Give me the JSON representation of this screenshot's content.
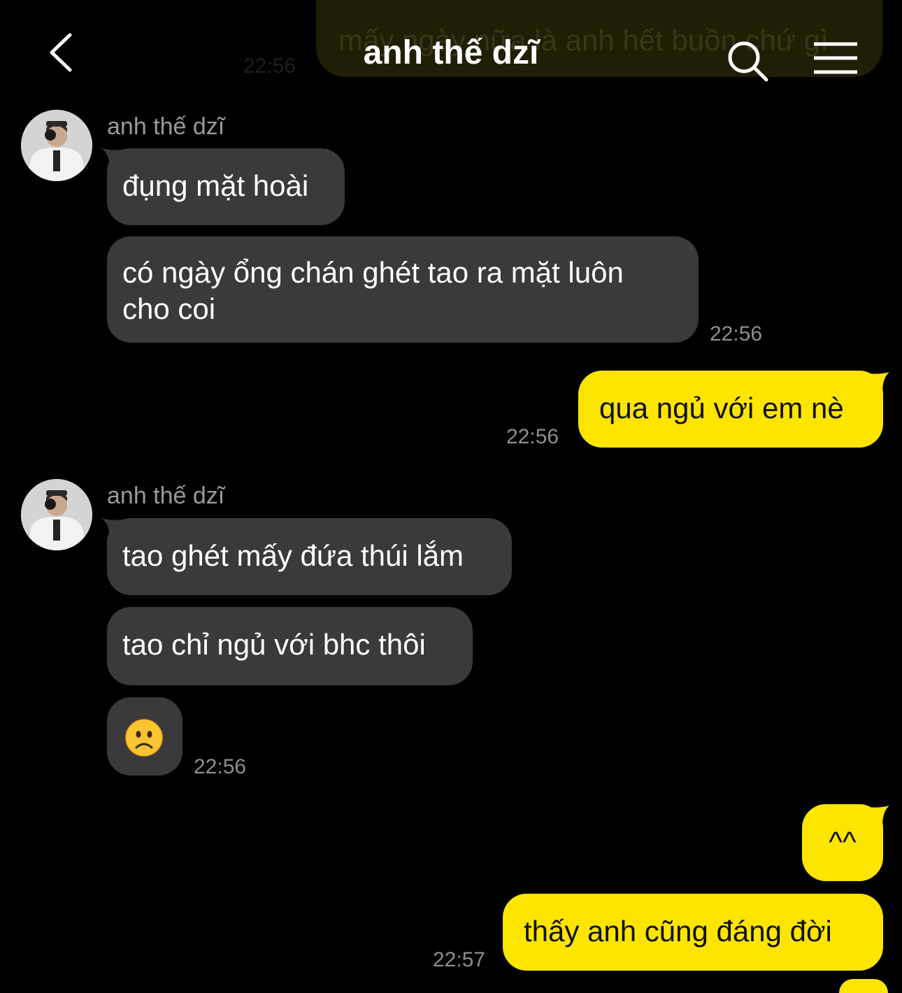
{
  "header": {
    "title": "anh thế dzĩ",
    "back_icon": "chevron-left-icon",
    "search_icon": "search-icon",
    "menu_icon": "hamburger-menu-icon",
    "faded_previous_message": "mấy ngày nữa là anh hết buồn chứ gì",
    "faded_previous_time": "22:56"
  },
  "messages": [
    {
      "sender": "anh thế dzĩ",
      "text": "đụng mặt hoài"
    },
    {
      "text_line1": "có ngày ổng chán ghét tao ra mặt luôn",
      "text_line2": "cho coi",
      "time": "22:56"
    },
    {
      "text": "qua ngủ với em nè",
      "time": "22:56"
    },
    {
      "sender": "anh thế dzĩ",
      "text": "tao ghét mấy đứa thúi lắm"
    },
    {
      "text": "tao chỉ ngủ với bhc thôi"
    },
    {
      "emoji": "☹",
      "time": "22:56"
    },
    {
      "text": "^^"
    },
    {
      "text": "thấy anh cũng đáng đời",
      "time": "22:57"
    }
  ],
  "colors": {
    "background": "#000000",
    "incoming_bubble": "#3a3a3c",
    "outgoing_bubble": "#fde500",
    "timestamp": "#8e8e8e"
  }
}
